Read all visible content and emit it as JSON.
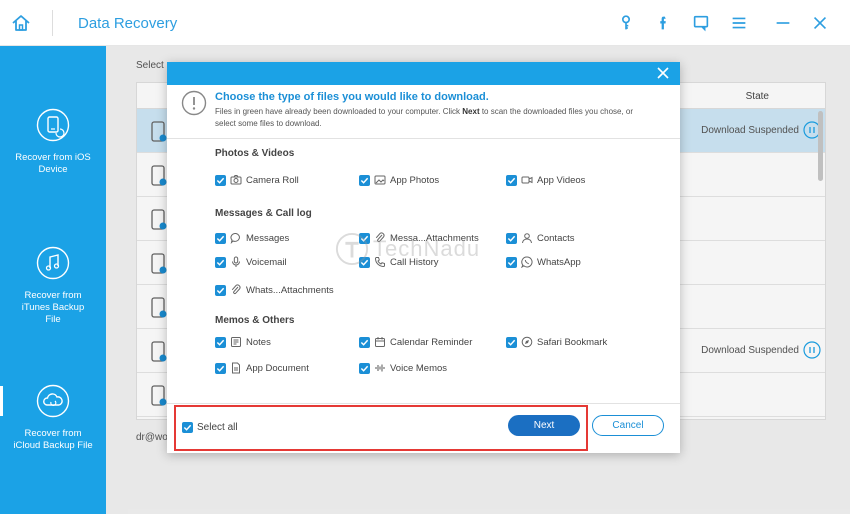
{
  "app": {
    "title": "Data Recovery"
  },
  "sidebar": {
    "items": [
      {
        "label_line1": "Recover from iOS",
        "label_line2": "Device",
        "label_line3": "",
        "icon": "phone-restore-icon"
      },
      {
        "label_line1": "Recover from",
        "label_line2": "iTunes Backup",
        "label_line3": "File",
        "icon": "music-note-icon"
      },
      {
        "label_line1": "Recover from",
        "label_line2": "iCloud Backup File",
        "label_line3": "",
        "icon": "cloud-icon"
      }
    ]
  },
  "main": {
    "select_hint": "Select a",
    "state_header": "State",
    "rows": [
      {
        "state": "Download Suspended",
        "selected": true
      },
      {
        "state": "",
        "selected": false
      },
      {
        "state": "",
        "selected": false
      },
      {
        "state": "",
        "selected": false
      },
      {
        "state": "",
        "selected": false
      },
      {
        "state": "Download Suspended",
        "selected": false
      },
      {
        "state": "",
        "selected": false
      }
    ],
    "email_fragment": "dr@wo"
  },
  "dialog": {
    "heading": "Choose the type of files you would like to download.",
    "desc_part1": "Files in green have already been downloaded to your computer. Click ",
    "desc_bold": "Next",
    "desc_part2": " to scan the downloaded files you chose, or select some files to download.",
    "groups": [
      {
        "title": "Photos & Videos",
        "options": [
          "Camera Roll",
          "App Photos",
          "App Videos"
        ]
      },
      {
        "title": "Messages & Call log",
        "options": [
          "Messages",
          "Messa...Attachments",
          "Contacts",
          "Voicemail",
          "Call History",
          "WhatsApp",
          "Whats...Attachments"
        ]
      },
      {
        "title": "Memos & Others",
        "options": [
          "Notes",
          "Calendar  Reminder",
          "Safari Bookmark",
          "App Document",
          "Voice Memos"
        ]
      }
    ],
    "select_all": "Select all",
    "next": "Next",
    "cancel": "Cancel"
  },
  "watermark": "TechNadu",
  "colors": {
    "accent": "#1ba2e6",
    "checkbox": "#1b8fd6",
    "next_button": "#1b6fc2",
    "highlight": "#e53935"
  }
}
